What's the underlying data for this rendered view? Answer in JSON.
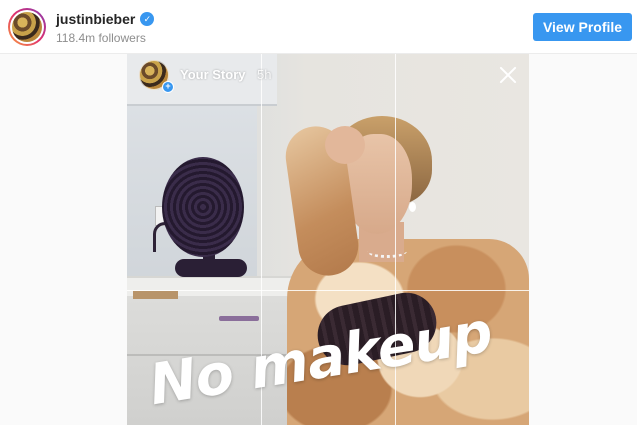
{
  "header": {
    "username": "justinbieber",
    "verified_glyph": "✓",
    "followers": "118.4m followers",
    "view_profile_label": "View Profile"
  },
  "story": {
    "title": "Your Story",
    "time": "5h",
    "add_glyph": "+",
    "caption": "No makeup"
  },
  "icons": {
    "verified": "verified-badge-icon",
    "close": "close-icon",
    "add": "add-story-icon"
  },
  "colors": {
    "accent": "#3897f0",
    "text_primary": "#262626",
    "text_secondary": "#8e8e8e"
  }
}
